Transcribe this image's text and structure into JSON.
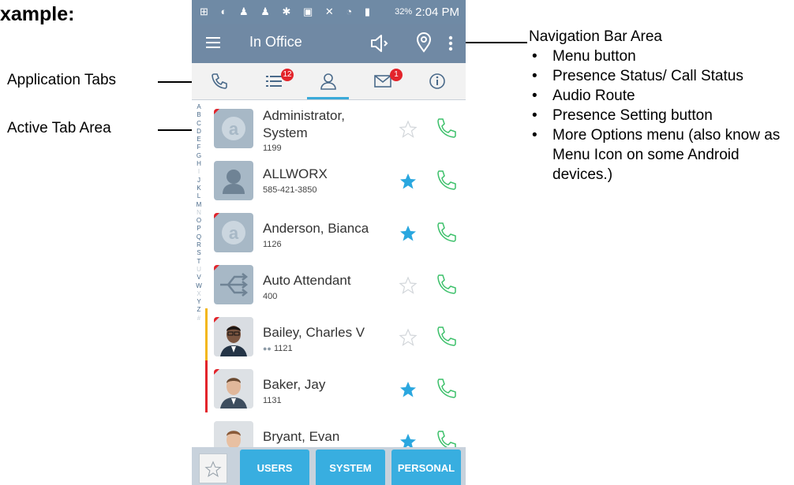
{
  "heading": "xample:",
  "annotations": {
    "application_tabs": "Application Tabs",
    "active_tab_area": "Active Tab Area",
    "navigation_bar_area": "Navigation Bar Area",
    "navigation_items": [
      "Menu button",
      "Presence Status/ Call Status",
      "Audio Route",
      "Presence Setting button",
      "More Options menu (also know as Menu Icon on some Android devices.)"
    ]
  },
  "statusbar": {
    "battery": "32%",
    "time": "2:04 PM"
  },
  "navbar": {
    "status_title": "In Office",
    "icons": [
      "menu-icon",
      "speaker-icon",
      "location-pin-icon",
      "more-vert-icon"
    ]
  },
  "tabs": [
    {
      "name": "calls",
      "icon": "phone-icon",
      "badge": ""
    },
    {
      "name": "list",
      "icon": "list-icon",
      "badge": "12"
    },
    {
      "name": "contacts",
      "icon": "person-icon",
      "badge": "",
      "active": true
    },
    {
      "name": "messages",
      "icon": "envelope-icon",
      "badge": "1"
    },
    {
      "name": "info",
      "icon": "info-icon",
      "badge": ""
    }
  ],
  "alphabet": [
    "A",
    "B",
    "C",
    "D",
    "E",
    "F",
    "G",
    "H",
    "I",
    "J",
    "K",
    "L",
    "M",
    "N",
    "O",
    "P",
    "Q",
    "R",
    "S",
    "T",
    "U",
    "V",
    "W",
    "X",
    "Y",
    "Z",
    "#"
  ],
  "contacts": [
    {
      "name_line1": "Administrator,",
      "name_line2": "System",
      "ext": "1199",
      "favorite": false,
      "avatar": "allworx-logo"
    },
    {
      "name_line1": "ALLWORX",
      "name_line2": "",
      "ext": "585-421-3850",
      "favorite": true,
      "avatar": "person-silhouette"
    },
    {
      "name_line1": "Anderson, Bianca",
      "name_line2": "",
      "ext": "1126",
      "favorite": true,
      "avatar": "allworx-logo"
    },
    {
      "name_line1": "Auto Attendant",
      "name_line2": "",
      "ext": "400",
      "favorite": false,
      "avatar": "routing-arrows"
    },
    {
      "name_line1": "Bailey, Charles V",
      "name_line2": "",
      "ext": "1121",
      "favorite": false,
      "avatar": "photo",
      "group_icon": true,
      "status_color": "#f3b71a"
    },
    {
      "name_line1": "Baker, Jay",
      "name_line2": "",
      "ext": "1131",
      "favorite": true,
      "avatar": "photo",
      "status_color": "#e3242b"
    },
    {
      "name_line1": "Bryant, Evan",
      "name_line2": "",
      "ext": "",
      "favorite": true,
      "avatar": "photo"
    }
  ],
  "bottombar": {
    "buttons": [
      "USERS",
      "SYSTEM",
      "PERSONAL"
    ]
  },
  "colors": {
    "nav_blue": "#7089a4",
    "accent": "#38aee0",
    "call_green": "#3cc06a",
    "favorite_blue": "#2aa7df"
  }
}
